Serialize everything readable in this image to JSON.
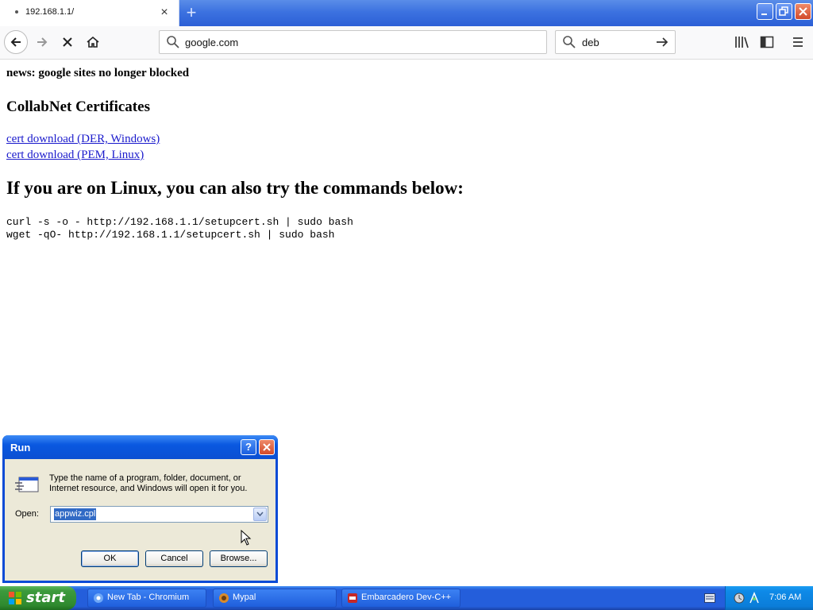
{
  "browser": {
    "tab_title": "192.168.1.1/",
    "tab_close": "×",
    "new_tab": "+",
    "url": "google.com",
    "search_query": "deb"
  },
  "page": {
    "news": "news: google sites no longer blocked",
    "certs_heading": "CollabNet Certificates",
    "link_der": "cert download (DER, Windows)",
    "link_pem": "cert download (PEM, Linux)",
    "linux_heading": "If you are on Linux, you can also try the commands below:",
    "cmd_curl": "curl -s -o - http://192.168.1.1/setupcert.sh | sudo bash",
    "cmd_wget": "wget -qO- http://192.168.1.1/setupcert.sh | sudo bash"
  },
  "run_dialog": {
    "title": "Run",
    "description": "Type the name of a program, folder, document, or Internet resource, and Windows will open it for you.",
    "open_label": "Open:",
    "open_value": "appwiz.cpl",
    "ok": "OK",
    "cancel": "Cancel",
    "browse": "Browse..."
  },
  "taskbar": {
    "start": "start",
    "tasks": [
      "New Tab - Chromium",
      "Mypal",
      "Embarcadero Dev-C++"
    ],
    "clock": "7:06 AM"
  }
}
